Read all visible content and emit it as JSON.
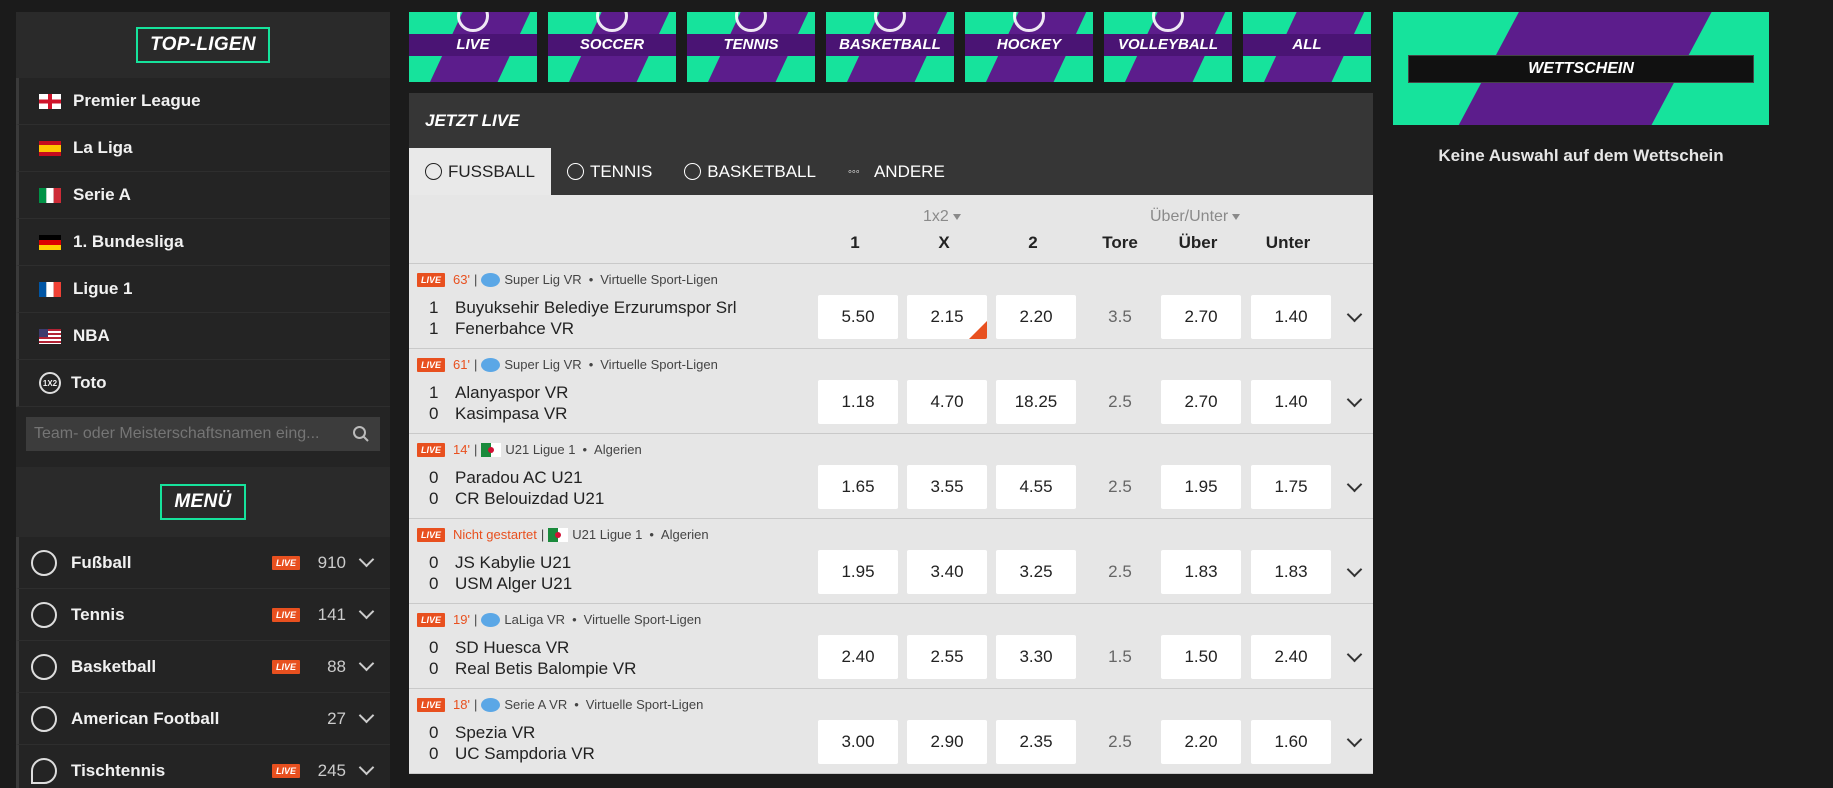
{
  "sidebar": {
    "top_title": "TOP-LIGEN",
    "leagues": [
      {
        "label": "Premier League",
        "flag": "england"
      },
      {
        "label": "La Liga",
        "flag": "spain"
      },
      {
        "label": "Serie A",
        "flag": "italy"
      },
      {
        "label": "1. Bundesliga",
        "flag": "germany"
      },
      {
        "label": "Ligue 1",
        "flag": "france"
      },
      {
        "label": "NBA",
        "flag": "usa"
      }
    ],
    "toto": {
      "label": "Toto",
      "icon_text": "1X2"
    },
    "search_placeholder": "Team- oder Meisterschaftsnamen eing...",
    "menu_title": "MENÜ",
    "live_label": "LIVE",
    "sports": [
      {
        "label": "Fußball",
        "live": true,
        "count": "910"
      },
      {
        "label": "Tennis",
        "live": true,
        "count": "141"
      },
      {
        "label": "Basketball",
        "live": true,
        "count": "88"
      },
      {
        "label": "American Football",
        "live": false,
        "count": "27"
      },
      {
        "label": "Tischtennis",
        "live": true,
        "count": "245"
      }
    ]
  },
  "tiles": [
    "LIVE",
    "SOCCER",
    "TENNIS",
    "BASKETBALL",
    "HOCKEY",
    "VOLLEYBALL",
    "ALL"
  ],
  "live": {
    "title": "JETZT LIVE",
    "tabs": [
      "FUSSBALL",
      "TENNIS",
      "BASKETBALL",
      "ANDERE"
    ],
    "group_1x2": "1x2",
    "group_ou": "Über/Unter",
    "cols": [
      "1",
      "X",
      "2",
      "Tore",
      "Über",
      "Unter"
    ],
    "live_label": "LIVE",
    "matches": [
      {
        "minute": "63'",
        "flag": "globe",
        "league": "Super Lig VR",
        "region": "Virtuelle Sport-Ligen",
        "home": "Buyuksehir Belediye Erzurumspor Srl",
        "away": "Fenerbahce VR",
        "hs": "1",
        "as": "1",
        "o1": "5.50",
        "ox": "2.15",
        "o2": "2.20",
        "tore": "3.5",
        "over": "2.70",
        "under": "1.40",
        "flagged": true
      },
      {
        "minute": "61'",
        "flag": "globe",
        "league": "Super Lig VR",
        "region": "Virtuelle Sport-Ligen",
        "home": "Alanyaspor VR",
        "away": "Kasimpasa VR",
        "hs": "1",
        "as": "0",
        "o1": "1.18",
        "ox": "4.70",
        "o2": "18.25",
        "tore": "2.5",
        "over": "2.70",
        "under": "1.40"
      },
      {
        "minute": "14'",
        "flag": "algeria",
        "league": "U21 Ligue 1",
        "region": "Algerien",
        "home": "Paradou AC U21",
        "away": "CR Belouizdad U21",
        "hs": "0",
        "as": "0",
        "o1": "1.65",
        "ox": "3.55",
        "o2": "4.55",
        "tore": "2.5",
        "over": "1.95",
        "under": "1.75"
      },
      {
        "minute": "Nicht gestartet",
        "flag": "algeria",
        "league": "U21 Ligue 1",
        "region": "Algerien",
        "home": "JS Kabylie U21",
        "away": "USM Alger U21",
        "hs": "0",
        "as": "0",
        "o1": "1.95",
        "ox": "3.40",
        "o2": "3.25",
        "tore": "2.5",
        "over": "1.83",
        "under": "1.83"
      },
      {
        "minute": "19'",
        "flag": "globe",
        "league": "LaLiga VR",
        "region": "Virtuelle Sport-Ligen",
        "home": "SD Huesca VR",
        "away": "Real Betis Balompie VR",
        "hs": "0",
        "as": "0",
        "o1": "2.40",
        "ox": "2.55",
        "o2": "3.30",
        "tore": "1.5",
        "over": "1.50",
        "under": "2.40"
      },
      {
        "minute": "18'",
        "flag": "globe",
        "league": "Serie A VR",
        "region": "Virtuelle Sport-Ligen",
        "home": "Spezia VR",
        "away": "UC Sampdoria VR",
        "hs": "0",
        "as": "0",
        "o1": "3.00",
        "ox": "2.90",
        "o2": "2.35",
        "tore": "2.5",
        "over": "2.20",
        "under": "1.60"
      }
    ]
  },
  "slip": {
    "title": "WETTSCHEIN",
    "empty": "Keine Auswahl auf dem Wettschein"
  },
  "colors": {
    "accent": "#16e39c",
    "brand_purple": "#5c1d8c",
    "live_orange": "#e8501f"
  }
}
